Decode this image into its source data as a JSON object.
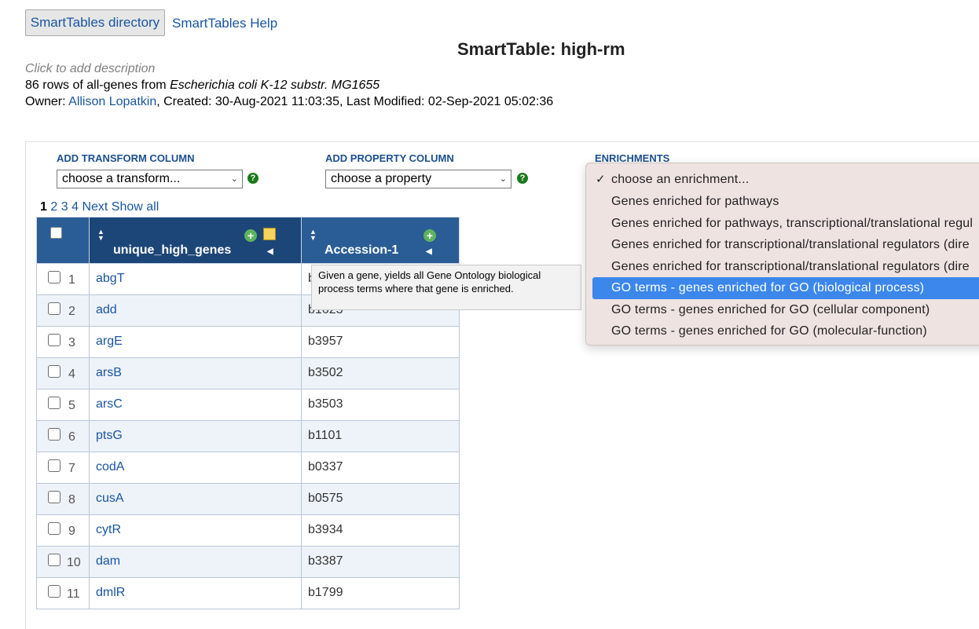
{
  "header": {
    "directory_button": "SmartTables directory",
    "help_link": "SmartTables Help",
    "title": "SmartTable: high-rm",
    "description_placeholder": "Click to add description",
    "rows_prefix": "86 rows of all-genes from ",
    "organism": "Escherichia coli K-12 substr. MG1655",
    "owner_label": "Owner: ",
    "owner_name": "Allison Lopatkin",
    "created_modified": ", Created: 30-Aug-2021 11:03:35, Last Modified: 02-Sep-2021 05:02:36"
  },
  "controls": {
    "transform_label": "ADD TRANSFORM COLUMN",
    "transform_value": "choose a transform...",
    "property_label": "ADD PROPERTY COLUMN",
    "property_value": "choose a property",
    "enrichments_label": "ENRICHMENTS"
  },
  "pager": {
    "current": "1",
    "pages": [
      "2",
      "3",
      "4"
    ],
    "next": "Next",
    "show_all": "Show all"
  },
  "table": {
    "columns": [
      "unique_high_genes",
      "Accession-1"
    ],
    "rows": [
      {
        "n": "1",
        "gene": "abgT",
        "acc": "b1336"
      },
      {
        "n": "2",
        "gene": "add",
        "acc": "b1623"
      },
      {
        "n": "3",
        "gene": "argE",
        "acc": "b3957"
      },
      {
        "n": "4",
        "gene": "arsB",
        "acc": "b3502"
      },
      {
        "n": "5",
        "gene": "arsC",
        "acc": "b3503"
      },
      {
        "n": "6",
        "gene": "ptsG",
        "acc": "b1101"
      },
      {
        "n": "7",
        "gene": "codA",
        "acc": "b0337"
      },
      {
        "n": "8",
        "gene": "cusA",
        "acc": "b0575"
      },
      {
        "n": "9",
        "gene": "cytR",
        "acc": "b3934"
      },
      {
        "n": "10",
        "gene": "dam",
        "acc": "b3387"
      },
      {
        "n": "11",
        "gene": "dmlR",
        "acc": "b1799"
      }
    ]
  },
  "tooltip": {
    "text": "Given a gene, yields all Gene Ontology biological process terms where that gene is enriched."
  },
  "enrichment_menu": {
    "selected_index": 4,
    "items": [
      "choose an enrichment...",
      "Genes enriched for pathways",
      "Genes enriched for pathways, transcriptional/translational regul",
      "Genes enriched for transcriptional/translational regulators (dire",
      "Genes enriched for transcriptional/translational regulators (dire",
      "GO terms - genes enriched for GO (biological process)",
      "GO terms - genes enriched for GO (cellular component)",
      "GO terms - genes enriched for GO (molecular-function)"
    ]
  },
  "colors": {
    "link": "#1a55a0",
    "header_bg": "#2a5d96",
    "header_dark": "#1d4678",
    "menu_bg": "#efe3e2",
    "menu_selected": "#3c87ec",
    "help_icon": "#1b7a1b"
  }
}
